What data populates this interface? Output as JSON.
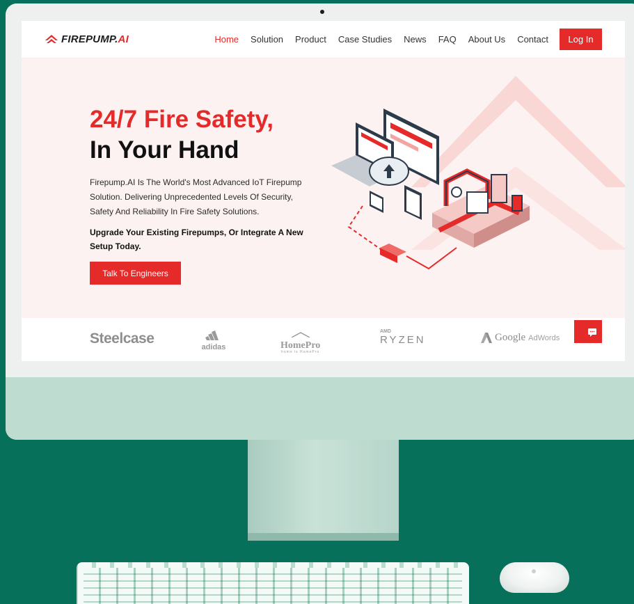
{
  "brand": {
    "name_part1": "FIREPUMP.",
    "name_part2": "AI",
    "accent_color": "#e52a2a",
    "dark_color": "#1f3d5c"
  },
  "nav": {
    "items": [
      {
        "label": "Home",
        "active": true
      },
      {
        "label": "Solution",
        "active": false
      },
      {
        "label": "Product",
        "active": false
      },
      {
        "label": "Case Studies",
        "active": false
      },
      {
        "label": "News",
        "active": false
      },
      {
        "label": "FAQ",
        "active": false
      },
      {
        "label": "About Us",
        "active": false
      },
      {
        "label": "Contact",
        "active": false
      }
    ],
    "login_label": "Log In"
  },
  "hero": {
    "headline_line1": "24/7 Fire Safety,",
    "headline_line2": "In Your Hand",
    "description": "Firepump.AI Is The World's Most Advanced IoT Firepump Solution. Delivering Unprecedented Levels Of Security, Safety And Reliability In Fire Safety Solutions.",
    "subtext": "Upgrade Your Existing Firepumps, Or Integrate A New Setup Today.",
    "cta_label": "Talk To Engineers"
  },
  "partners": {
    "steelcase": "Steelcase",
    "adidas": "adidas",
    "homepro": "HomePro",
    "homepro_tag": "home is HomePro",
    "amd": "AMD",
    "ryzen": "RYZEN",
    "google": "Google",
    "adwords": "AdWords"
  },
  "icons": {
    "logo": "flame-chevron-icon",
    "scroll_top": "chevron-up-icon",
    "chat": "chat-bubble-icon"
  }
}
